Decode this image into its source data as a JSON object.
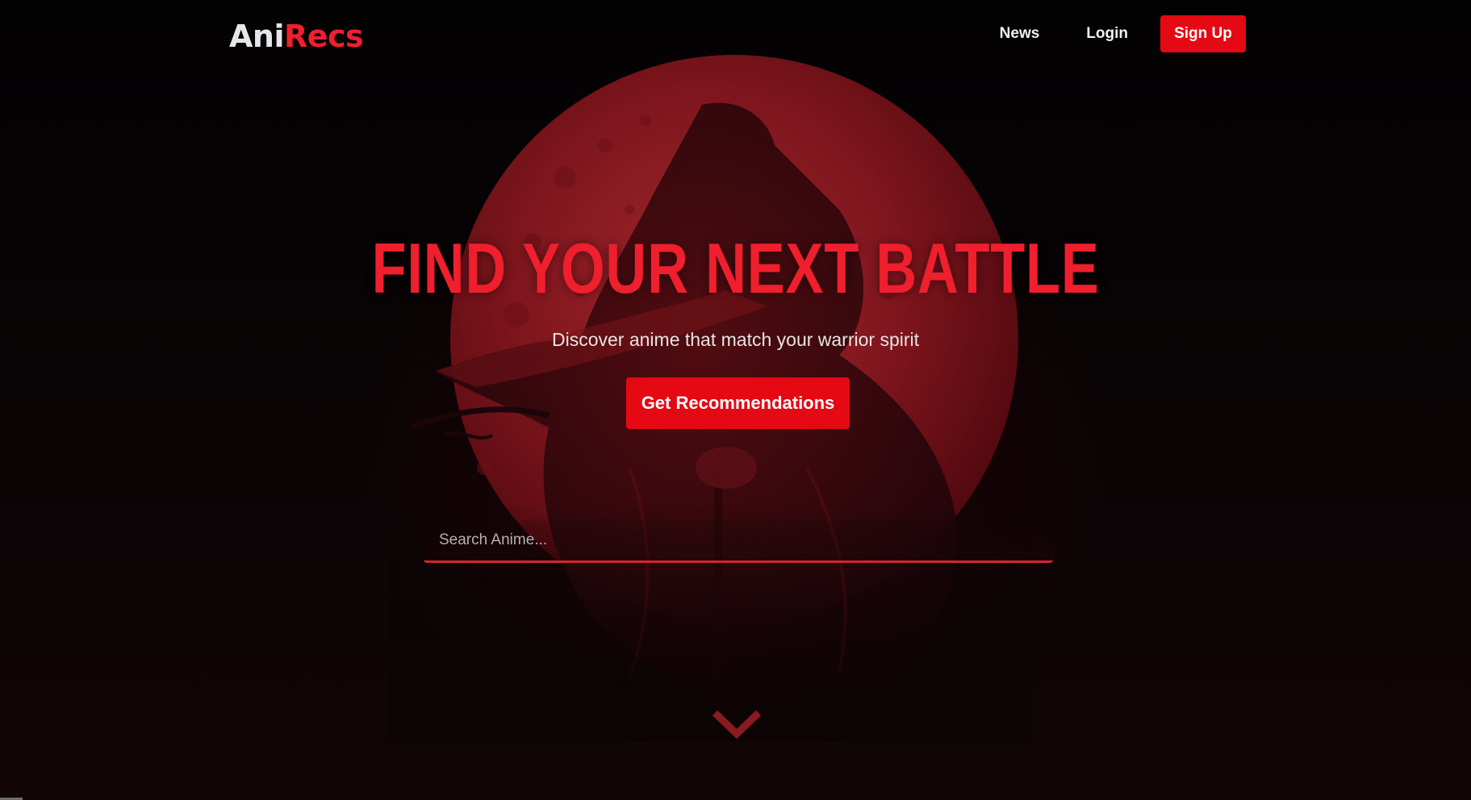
{
  "brand": {
    "name_part1": "Ani",
    "name_part2": "Recs"
  },
  "nav": {
    "links": [
      "News",
      "Login"
    ],
    "signup_label": "Sign Up"
  },
  "hero": {
    "title": "FIND YOUR NEXT BATTLE",
    "subtitle": "Discover anime that match your warrior spirit",
    "cta_label": "Get Recommendations",
    "background_icon": "blood-moon-warrior-artwork"
  },
  "search": {
    "placeholder": "Search Anime...",
    "value": ""
  },
  "scroll": {
    "icon": "chevron-down-icon"
  },
  "colors": {
    "accent": "#e50914",
    "title_red": "#ef1f2d",
    "background": "#050203",
    "logo_light": "#e6e6ea"
  }
}
